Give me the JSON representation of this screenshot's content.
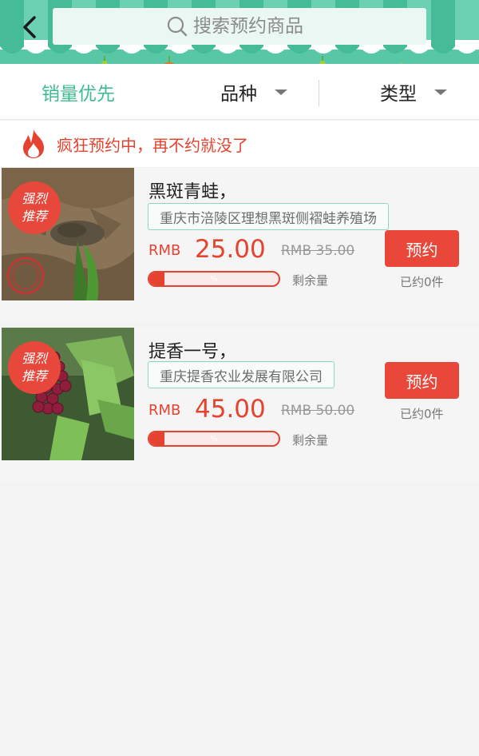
{
  "header": {
    "search": {
      "placeholder": "搜索预约商品"
    }
  },
  "filters": {
    "tabs": [
      {
        "label": "销量优先",
        "active": true,
        "has_caret": false
      },
      {
        "label": "品种",
        "active": false,
        "has_caret": true
      },
      {
        "label": "类型",
        "active": false,
        "has_caret": true
      }
    ]
  },
  "banner": {
    "text": "疯狂预约中，再不约就没了"
  },
  "products": [
    {
      "badge_line1": "强烈",
      "badge_line2": "推荐",
      "name": "黑斑青蛙，",
      "company": "重庆市涪陵区理想黑斑侧褶蛙养殖场",
      "currency": "RMB",
      "price": "25.00",
      "old_price": "RMB 35.00",
      "progress_percent": 12,
      "progress_label": "%",
      "remain_label": "剩余量",
      "book_label": "预约",
      "booked_label": "已约0件",
      "image_stamp": "无公害"
    },
    {
      "badge_line1": "强烈",
      "badge_line2": "推荐",
      "name": "提香一号，",
      "company": "重庆提香农业发展有限公司",
      "currency": "RMB",
      "price": "45.00",
      "old_price": "RMB 50.00",
      "progress_percent": 12,
      "progress_label": "%",
      "remain_label": "剩余量",
      "book_label": "预约",
      "booked_label": "已约0件"
    }
  ],
  "colors": {
    "accent_green": "#57c7a6",
    "accent_red": "#e5432f"
  }
}
